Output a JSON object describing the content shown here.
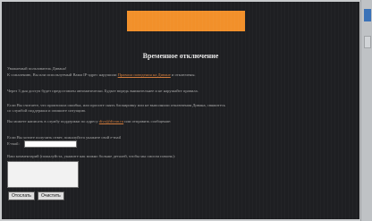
{
  "page": {
    "title": "Временное отключение",
    "greeting": "Уважаемый пользователь Дивана!",
    "line1_pre": "К сожалению, Вы или используемый Вами IP-адрес нарушили",
    "line1_link": "Правила поведения на Диване",
    "line1_post": "и отключены.",
    "line2": "Через 3 дня доступ будет предоставлен автоматически. Будьте впредь внимательнее и не нарушайте правила.",
    "line3a": "Если Вы считаете, что произошла ошибка, или просите снять блокировку или не выполнили отключения Дивана, свяжитесь",
    "line3b": "со службой поддержки и опишите ситуацию.",
    "line4_pre": "Вы можете написать в службу поддержки по адресу",
    "line4_link": "diva@divan.ru",
    "line4_post": "или отправить сообщение:",
    "line5": "Если Вы хотите получить ответ, пожалуйста укажите свой e-mail",
    "email_label": "E-mail:",
    "email_value": "",
    "line6": "Ваш комментарий (пожалуйста, укажите как можно больше деталей, чтобы мы смогли помочь):",
    "comment_value": "",
    "send_button": "Отослать",
    "clear_button": "Очистить"
  },
  "colors": {
    "background": "#1e1f22",
    "banner": "#f2902a",
    "text": "#a9a9a9",
    "link": "#d07a3a"
  }
}
